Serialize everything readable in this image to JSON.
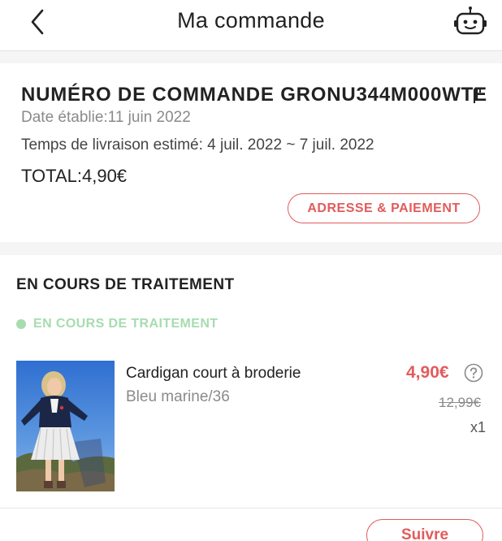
{
  "header": {
    "title": "Ma commande"
  },
  "order": {
    "number": "NUMÉRO DE COMMANDE GRONU344M000WTE",
    "date": "Date établie:11 juin 2022",
    "delivery": "Temps de livraison estimé: 4 juil. 2022 ~ 7 juil. 2022",
    "total": "TOTAL:4,90€",
    "address_payment_label": "ADRESSE & PAIEMENT"
  },
  "processing": {
    "section_title": "EN COURS DE TRAITEMENT",
    "status_label": "EN COURS DE TRAITEMENT",
    "status_color": "#a6dcae"
  },
  "product": {
    "name": "Cardigan court à broderie",
    "variant": "Bleu marine/36",
    "price_sale": "4,90€",
    "price_original": "12,99€",
    "quantity": "x1"
  },
  "actions": {
    "track_label": "Suivre"
  },
  "colors": {
    "accent": "#e25b5b",
    "status_green": "#a6dcae",
    "background_gray": "#f5f5f5"
  },
  "icons": {
    "back": "chevron-left-icon",
    "assistant": "robot-icon",
    "copy": "copy-icon",
    "help": "question-circle-icon"
  }
}
